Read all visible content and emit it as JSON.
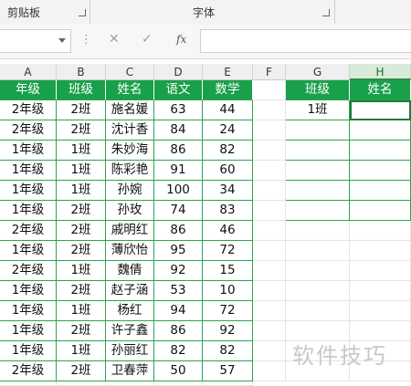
{
  "ribbon": {
    "clipboard_label": "剪贴板",
    "font_label": "字体"
  },
  "formula_bar": {
    "name_box_value": "",
    "formula_value": "",
    "cancel_icon": "✕",
    "enter_icon": "✓",
    "fx_label": "fx",
    "menu_dots": "⋮"
  },
  "columns": [
    "A",
    "B",
    "C",
    "D",
    "E",
    "F",
    "G",
    "H"
  ],
  "table": {
    "headers": [
      "年级",
      "班级",
      "姓名",
      "语文",
      "数学"
    ],
    "rows": [
      [
        "2年级",
        "2班",
        "施名媛",
        "63",
        "44"
      ],
      [
        "2年级",
        "2班",
        "沈计香",
        "84",
        "24"
      ],
      [
        "1年级",
        "1班",
        "朱妙海",
        "86",
        "82"
      ],
      [
        "1年级",
        "1班",
        "陈彩艳",
        "91",
        "60"
      ],
      [
        "1年级",
        "1班",
        "孙婉",
        "100",
        "34"
      ],
      [
        "1年级",
        "2班",
        "孙玫",
        "74",
        "83"
      ],
      [
        "2年级",
        "2班",
        "戚明红",
        "86",
        "46"
      ],
      [
        "1年级",
        "2班",
        "薄欣怡",
        "95",
        "72"
      ],
      [
        "2年级",
        "1班",
        "魏倩",
        "92",
        "15"
      ],
      [
        "1年级",
        "2班",
        "赵子涵",
        "53",
        "10"
      ],
      [
        "1年级",
        "1班",
        "杨红",
        "94",
        "72"
      ],
      [
        "1年级",
        "2班",
        "许子鑫",
        "86",
        "92"
      ],
      [
        "1年级",
        "1班",
        "孙丽红",
        "82",
        "82"
      ],
      [
        "2年级",
        "2班",
        "卫春萍",
        "50",
        "57"
      ]
    ]
  },
  "lookup": {
    "headers": [
      "班级",
      "姓名"
    ],
    "g2_value": "1班"
  },
  "watermark": "软件技巧",
  "colors": {
    "header_green": "#19a04a",
    "border_green": "#2da44e"
  }
}
